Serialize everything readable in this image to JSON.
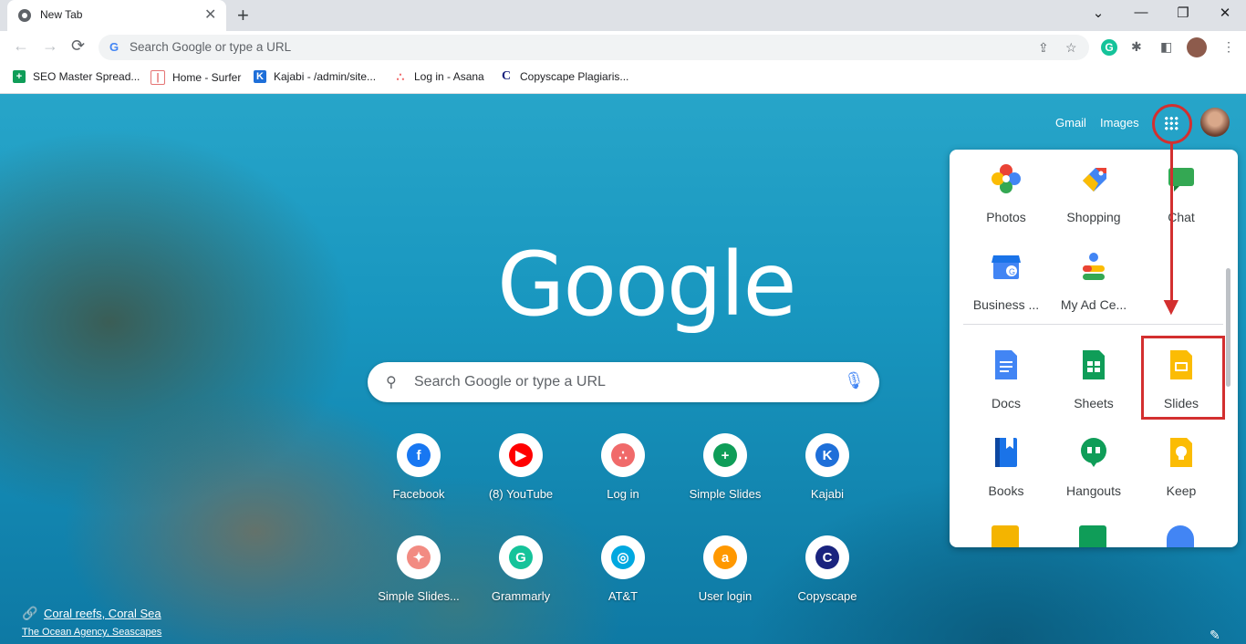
{
  "tab": {
    "title": "New Tab",
    "close": "✕",
    "new": "+"
  },
  "window": {
    "minimize": "—",
    "restore": "❐",
    "close": "✕",
    "dropdown": "⌄"
  },
  "nav": {
    "back": "←",
    "forward": "→",
    "reload": "⟳"
  },
  "omnibox": {
    "placeholder": "Search Google or type a URL",
    "g_icon": "G"
  },
  "bookmarks": [
    {
      "label": "SEO Master Spread...",
      "icon": "sheets-icon",
      "color": "#0f9d58"
    },
    {
      "label": "Home - Surfer",
      "icon": "surfer-icon",
      "color": "#e57373"
    },
    {
      "label": "Kajabi - /admin/site...",
      "icon": "kajabi-icon",
      "color": "#1e6fd9"
    },
    {
      "label": "Log in - Asana",
      "icon": "asana-icon",
      "color": "#f06a6a"
    },
    {
      "label": "Copyscape Plagiaris...",
      "icon": "copyscape-icon",
      "color": "#1a237e"
    }
  ],
  "header": {
    "gmail": "Gmail",
    "images": "Images"
  },
  "logo": "Google",
  "search": {
    "placeholder": "Search Google or type a URL"
  },
  "shortcuts": [
    {
      "label": "Facebook",
      "glyph": "f",
      "color": "#1877f2"
    },
    {
      "label": "(8) YouTube",
      "glyph": "▶",
      "color": "#ff0000"
    },
    {
      "label": "Log in",
      "glyph": "∴",
      "color": "#f06a6a"
    },
    {
      "label": "Simple Slides",
      "glyph": "+",
      "color": "#0f9d58"
    },
    {
      "label": "Kajabi",
      "glyph": "K",
      "color": "#1e6fd9"
    },
    {
      "label": "Simple Slides...",
      "glyph": "✦",
      "color": "#f28b82"
    },
    {
      "label": "Grammarly",
      "glyph": "G",
      "color": "#15c39a"
    },
    {
      "label": "AT&T",
      "glyph": "◎",
      "color": "#00a8e0"
    },
    {
      "label": "User login",
      "glyph": "a",
      "color": "#ff9800"
    },
    {
      "label": "Copyscape",
      "glyph": "C",
      "color": "#1a237e"
    }
  ],
  "credit": {
    "title": "Coral reefs, Coral Sea",
    "author": "The Ocean Agency, Seascapes"
  },
  "apps": [
    {
      "label": "Photos",
      "icon": "photos-icon"
    },
    {
      "label": "Shopping",
      "icon": "shopping-icon"
    },
    {
      "label": "Chat",
      "icon": "chat-icon"
    },
    {
      "label": "Business ...",
      "icon": "business-icon"
    },
    {
      "label": "My Ad Ce...",
      "icon": "ad-center-icon"
    },
    {
      "label": "Docs",
      "icon": "docs-icon"
    },
    {
      "label": "Sheets",
      "icon": "sheets-icon"
    },
    {
      "label": "Slides",
      "icon": "slides-icon"
    },
    {
      "label": "Books",
      "icon": "books-icon"
    },
    {
      "label": "Hangouts",
      "icon": "hangouts-icon"
    },
    {
      "label": "Keep",
      "icon": "keep-icon"
    }
  ],
  "colors": {
    "annotation": "#d32f2f",
    "blue": "#4285f4",
    "green": "#0f9d58",
    "yellow": "#fbbc04",
    "red": "#ea4335"
  }
}
